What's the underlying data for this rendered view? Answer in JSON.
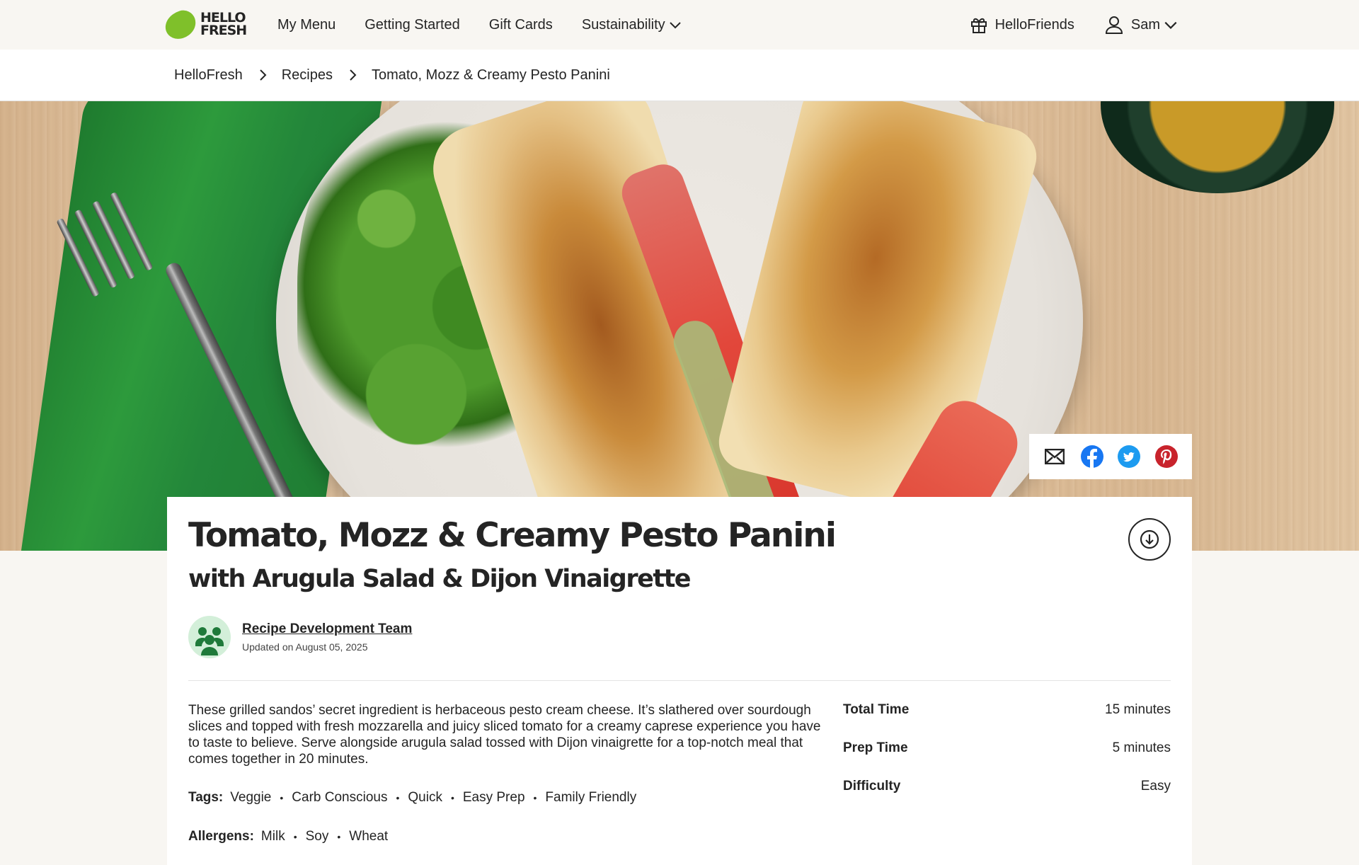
{
  "nav": {
    "logo_line1": "HELLO",
    "logo_line2": "FRESH",
    "links": [
      "My Menu",
      "Getting Started",
      "Gift Cards",
      "Sustainability"
    ],
    "hellofriends": "HelloFriends",
    "user": "Sam"
  },
  "breadcrumb": [
    "HelloFresh",
    "Recipes",
    "Tomato, Mozz & Creamy Pesto Panini"
  ],
  "share": {
    "icons": [
      "mail-icon",
      "facebook-icon",
      "twitter-icon",
      "pinterest-icon"
    ],
    "colors": {
      "facebook": "#1877f2",
      "twitter": "#1d9bf0",
      "pinterest": "#c8232c"
    }
  },
  "recipe": {
    "title": "Tomato, Mozz & Creamy Pesto Panini",
    "subtitle": "with Arugula Salad & Dijon Vinaigrette",
    "author": "Recipe Development Team",
    "updated": "Updated on August 05, 2025",
    "description": "These grilled sandos’ secret ingredient is herbaceous pesto cream cheese. It’s slathered over sourdough slices and topped with fresh mozzarella and juicy sliced tomato for a creamy caprese experience you have to taste to believe. Serve alongside arugula salad tossed with Dijon vinaigrette for a top-notch meal that comes together in 20 minutes.",
    "tags_label": "Tags:",
    "tags": [
      "Veggie",
      "Carb Conscious",
      "Quick",
      "Easy Prep",
      "Family Friendly"
    ],
    "allergens_label": "Allergens:",
    "allergens": [
      "Milk",
      "Soy",
      "Wheat"
    ],
    "meta": [
      {
        "label": "Total Time",
        "value": "15 minutes"
      },
      {
        "label": "Prep Time",
        "value": "5 minutes"
      },
      {
        "label": "Difficulty",
        "value": "Easy"
      }
    ]
  },
  "colors": {
    "brand_green": "#7fc02a",
    "text": "#242424",
    "background": "#f8f6f2"
  }
}
